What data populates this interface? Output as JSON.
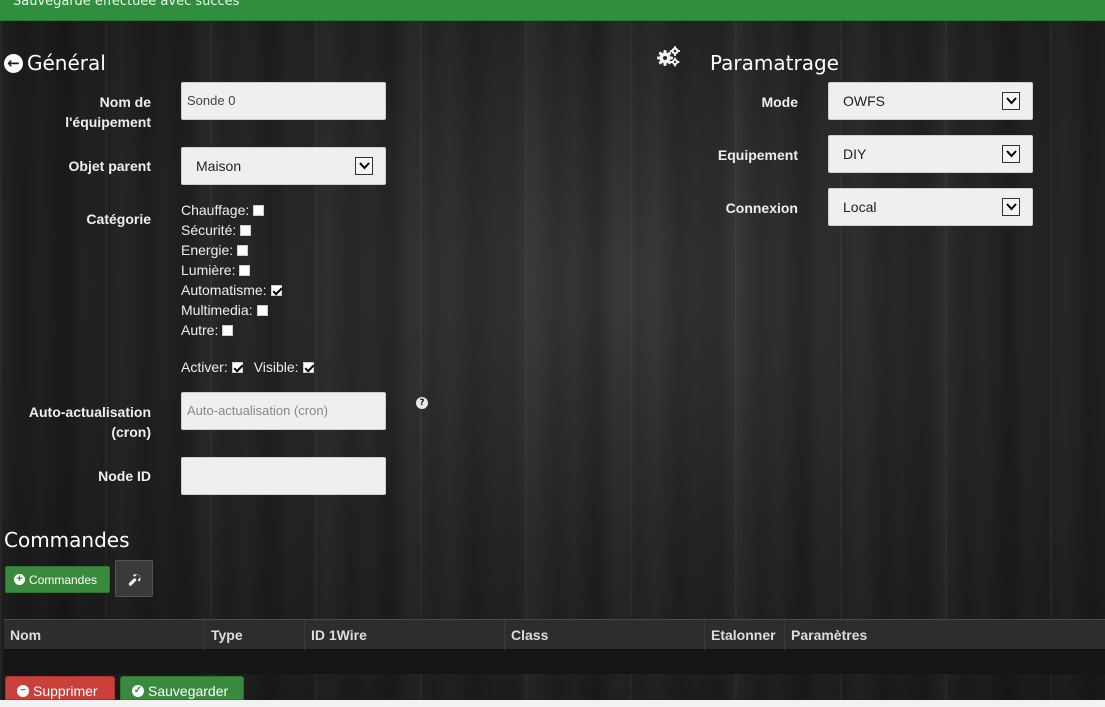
{
  "alert": {
    "message": "Sauvegarde effectuée avec succès"
  },
  "general": {
    "title": "Général",
    "name_label": [
      "Nom de",
      "l'équipement"
    ],
    "name_value": "Sonde 0",
    "parent_label": "Objet parent",
    "parent_value": "Maison",
    "category_label": "Catégorie",
    "categories": [
      {
        "label": "Chauffage:",
        "checked": false
      },
      {
        "label": "Sécurité:",
        "checked": false
      },
      {
        "label": "Energie:",
        "checked": false
      },
      {
        "label": "Lumière:",
        "checked": false
      },
      {
        "label": "Automatisme:",
        "checked": true
      },
      {
        "label": "Multimedia:",
        "checked": false
      },
      {
        "label": "Autre:",
        "checked": false
      }
    ],
    "activate_label": "Activer:",
    "activate_checked": true,
    "visible_label": "Visible:",
    "visible_checked": true,
    "autorefresh_label": [
      "Auto-actualisation",
      "(cron)"
    ],
    "autorefresh_placeholder": "Auto-actualisation (cron)",
    "help_glyph": "?",
    "node_label": "Node ID",
    "node_value": ""
  },
  "settings": {
    "title": "Paramatrage",
    "mode_label": "Mode",
    "mode_value": "OWFS",
    "equipment_label": "Equipement",
    "equipment_value": "DIY",
    "connection_label": "Connexion",
    "connection_value": "Local"
  },
  "commands": {
    "title": "Commandes",
    "add_button": "Commandes",
    "columns": [
      "Nom",
      "Type",
      "ID 1Wire",
      "Class",
      "Etalonner",
      "Paramètres"
    ]
  },
  "footer": {
    "delete_button": "Supprimer",
    "save_button": "Sauvegarder"
  },
  "icons": {
    "back": "arrow-circle-left-icon",
    "gears": "gears-icon",
    "help": "question-circle-icon",
    "plus": "plus-circle-icon",
    "wrench": "wrench-icon",
    "minus": "minus-circle-icon",
    "check": "check-circle-icon"
  },
  "colors": {
    "success": "#2f8f3f",
    "danger": "#c9403a",
    "button_green": "#3a8a3e"
  }
}
